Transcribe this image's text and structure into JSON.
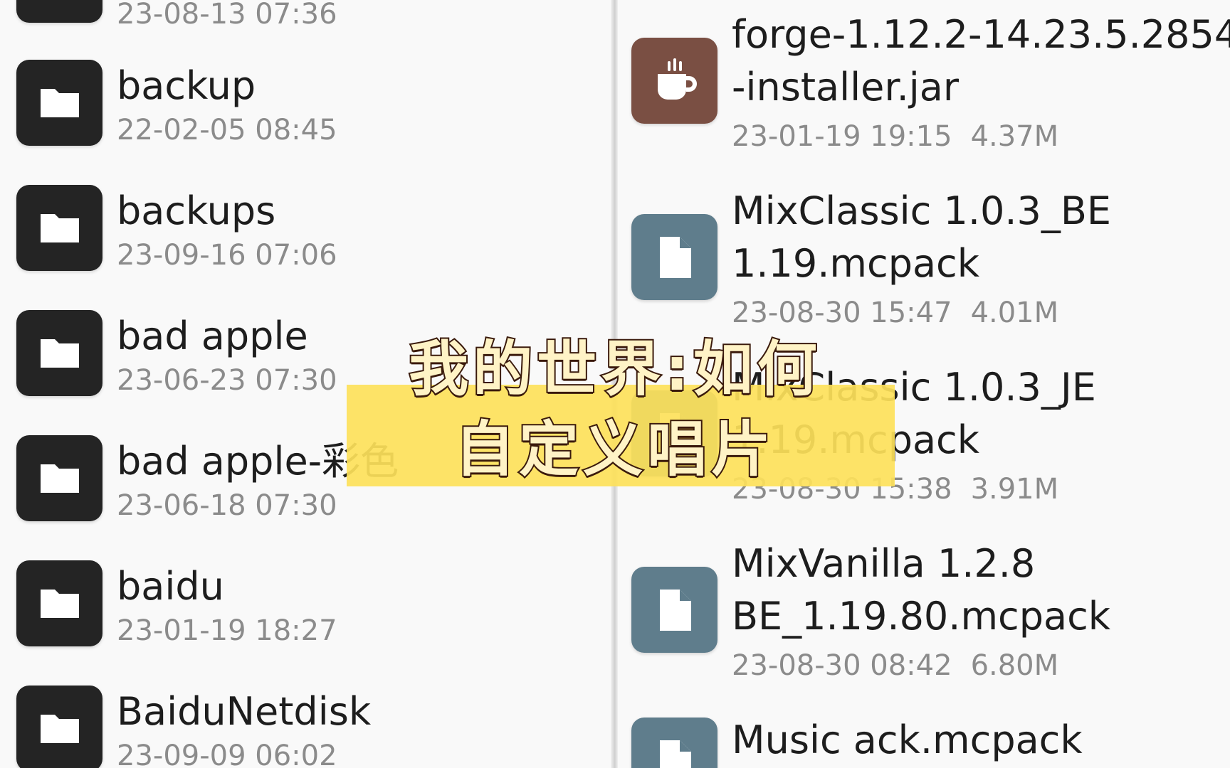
{
  "left_pane": {
    "items": [
      {
        "name": "",
        "meta": "23-08-13 07:36",
        "icon": "folder-icon"
      },
      {
        "name": "backup",
        "meta": "22-02-05 08:45",
        "icon": "folder-icon"
      },
      {
        "name": "backups",
        "meta": "23-09-16 07:06",
        "icon": "folder-icon"
      },
      {
        "name": "bad apple",
        "meta": "23-06-23 07:30",
        "icon": "folder-icon"
      },
      {
        "name": "bad apple-彩色",
        "meta": "23-06-18 07:30",
        "icon": "folder-icon"
      },
      {
        "name": "baidu",
        "meta": "23-01-19 18:27",
        "icon": "folder-icon"
      },
      {
        "name": "BaiduNetdisk",
        "meta": "23-09-09 06:02",
        "icon": "folder-icon"
      }
    ]
  },
  "right_pane": {
    "items": [
      {
        "name_line1": "forge-1.12.2-14.23.5.2854",
        "name_line2": "-installer.jar",
        "date": "23-01-19 19:15",
        "size": "4.37M",
        "icon": "java-cup-icon",
        "icon_color": "#7a4f43"
      },
      {
        "name_line1": "MixClassic 1.0.3_BE",
        "name_line2": "1.19.mcpack",
        "date": "23-08-30 15:47",
        "size": "4.01M",
        "icon": "file-icon",
        "icon_color": "#5f7d8c"
      },
      {
        "name_line1": "MixClassic 1.0.3_JE",
        "name_line2": "1.19.mcpack",
        "date": "23-08-30 15:38",
        "size": "3.91M",
        "icon": "file-icon",
        "icon_color": "#5f7d8c"
      },
      {
        "name_line1": "MixVanilla 1.2.8",
        "name_line2": "BE_1.19.80.mcpack",
        "date": "23-08-30 08:42",
        "size": "6.80M",
        "icon": "file-icon",
        "icon_color": "#5f7d8c"
      },
      {
        "name_line1": "Music ack.mcpack",
        "name_line2": "",
        "date": "",
        "size": "",
        "icon": "file-icon",
        "icon_color": "#5f7d8c"
      }
    ]
  },
  "caption": {
    "line1": "我的世界:如何",
    "line2": "自定义唱片",
    "band_color": "#fde15a"
  }
}
